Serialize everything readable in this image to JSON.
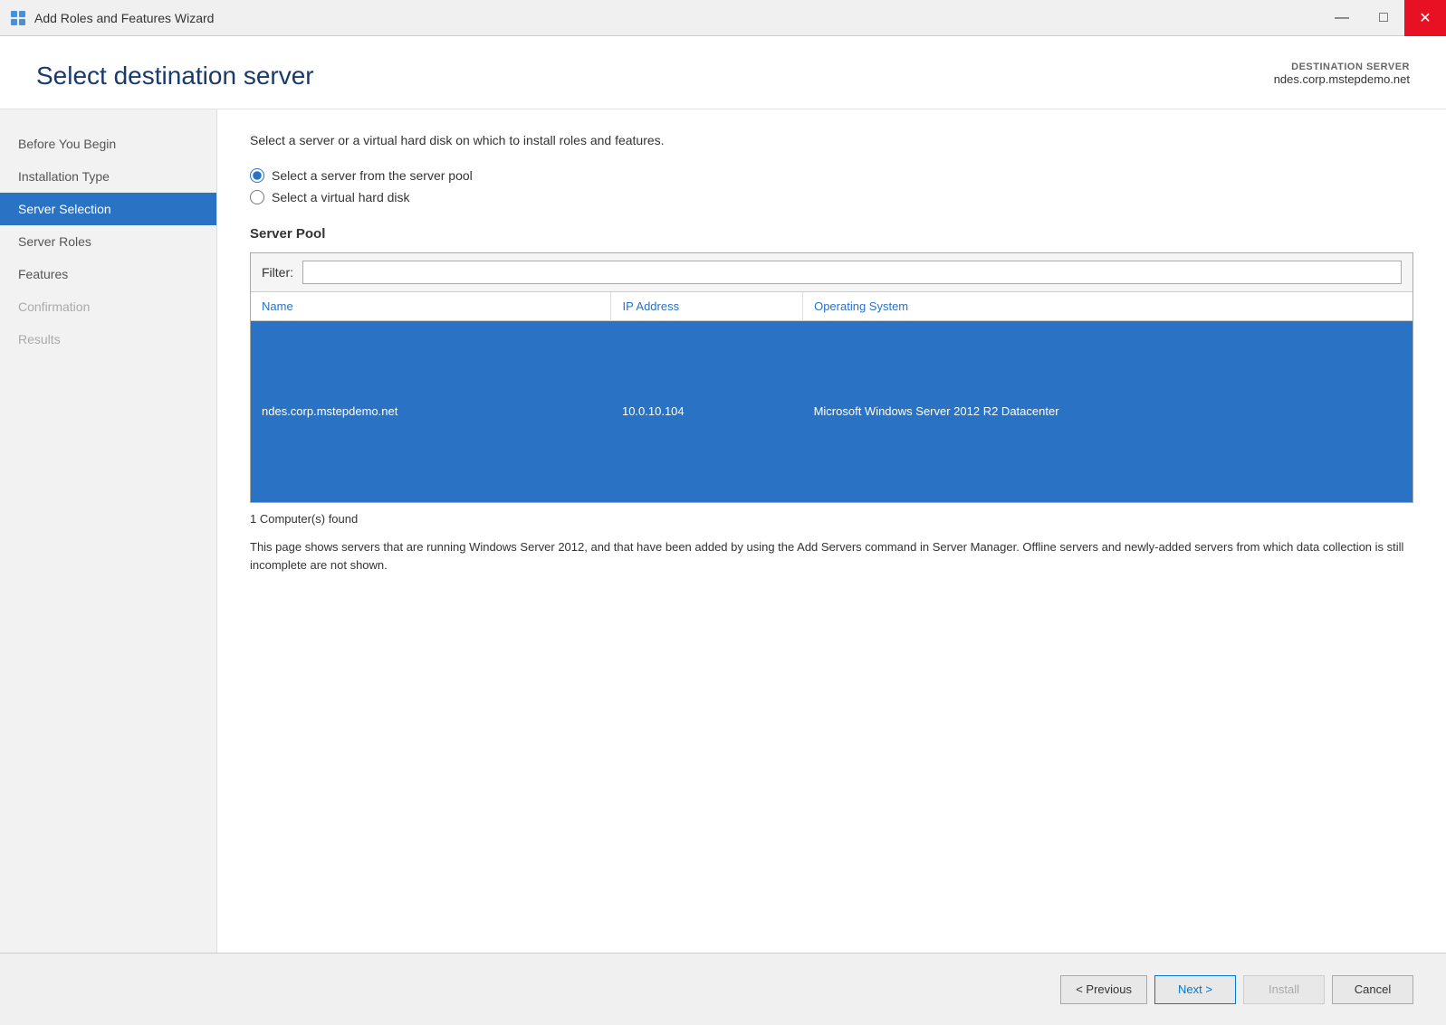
{
  "titleBar": {
    "title": "Add Roles and Features Wizard",
    "icon": "wizard-icon"
  },
  "header": {
    "title": "Select destination server",
    "destinationLabel": "DESTINATION SERVER",
    "destinationName": "ndes.corp.mstepdemo.net"
  },
  "sidebar": {
    "items": [
      {
        "id": "before-you-begin",
        "label": "Before You Begin",
        "state": "normal"
      },
      {
        "id": "installation-type",
        "label": "Installation Type",
        "state": "normal"
      },
      {
        "id": "server-selection",
        "label": "Server Selection",
        "state": "active"
      },
      {
        "id": "server-roles",
        "label": "Server Roles",
        "state": "normal"
      },
      {
        "id": "features",
        "label": "Features",
        "state": "normal"
      },
      {
        "id": "confirmation",
        "label": "Confirmation",
        "state": "disabled"
      },
      {
        "id": "results",
        "label": "Results",
        "state": "disabled"
      }
    ]
  },
  "content": {
    "description": "Select a server or a virtual hard disk on which to install roles and features.",
    "radio1": "Select a server from the server pool",
    "radio2": "Select a virtual hard disk",
    "sectionTitle": "Server Pool",
    "filterLabel": "Filter:",
    "filterPlaceholder": "",
    "tableHeaders": [
      "Name",
      "IP Address",
      "Operating System"
    ],
    "tableRows": [
      {
        "name": "ndes.corp.mstepdemo.net",
        "ipAddress": "10.0.10.104",
        "operatingSystem": "Microsoft Windows Server 2012 R2 Datacenter",
        "selected": true
      }
    ],
    "computersFound": "1 Computer(s) found",
    "infoText": "This page shows servers that are running Windows Server 2012, and that have been added by using the Add Servers command in Server Manager. Offline servers and newly-added servers from which data collection is still incomplete are not shown."
  },
  "footer": {
    "previousLabel": "< Previous",
    "nextLabel": "Next >",
    "installLabel": "Install",
    "cancelLabel": "Cancel"
  }
}
